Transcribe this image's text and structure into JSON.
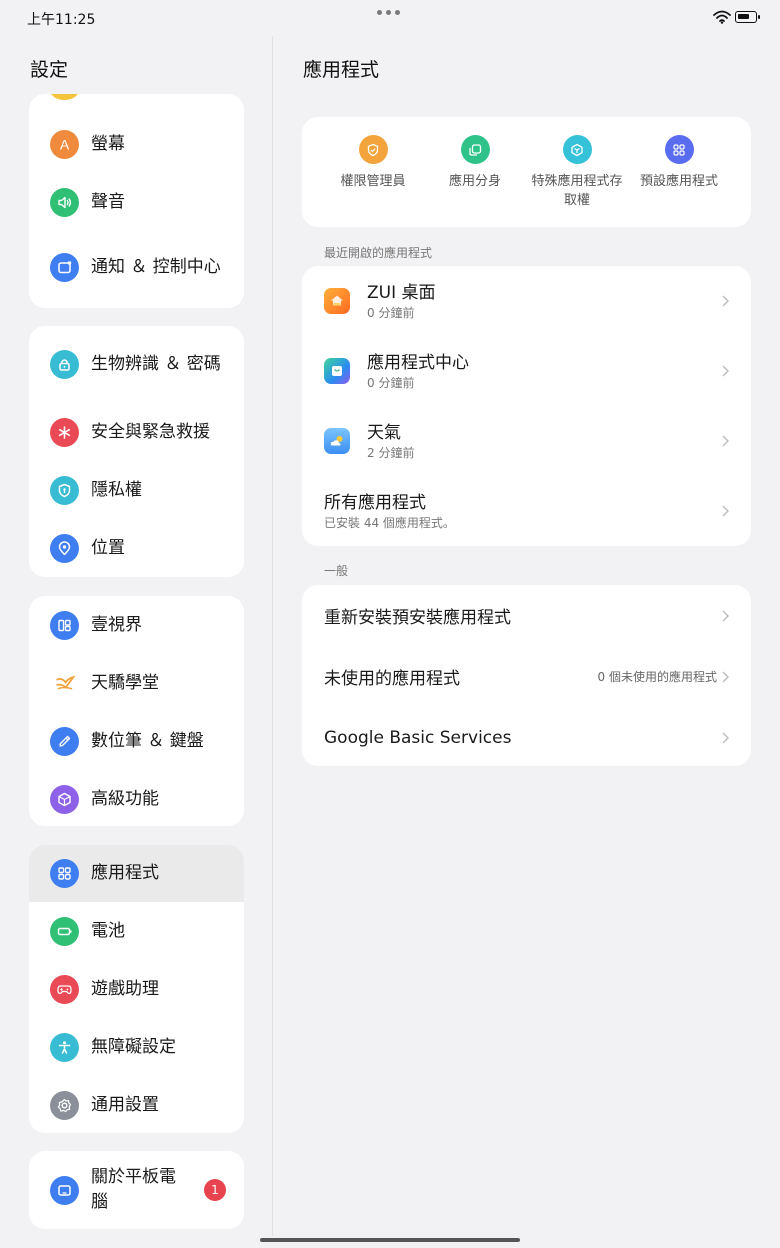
{
  "status_bar": {
    "time": "上午11:25"
  },
  "sidebar": {
    "title": "設定",
    "groups": [
      {
        "items": [
          {
            "label": "螢幕",
            "icon": "display-icon",
            "color": "#f08a3c"
          },
          {
            "label": "聲音",
            "icon": "speaker-icon",
            "color": "#2fbf75"
          },
          {
            "label": "通知 ＆ 控制中心",
            "icon": "notification-icon",
            "color": "#3f7ef0"
          }
        ]
      },
      {
        "items": [
          {
            "label": "生物辨識 ＆ 密碼",
            "icon": "lock-icon",
            "color": "#38bcd4"
          },
          {
            "label": "安全與緊急救援",
            "icon": "emergency-icon",
            "color": "#ea4a55"
          },
          {
            "label": "隱私權",
            "icon": "privacy-shield-icon",
            "color": "#38bcd4"
          },
          {
            "label": "位置",
            "icon": "location-pin-icon",
            "color": "#3f7ef0"
          }
        ]
      },
      {
        "items": [
          {
            "label": "壹視界",
            "icon": "multi-window-icon",
            "color": "#3f7ef0"
          },
          {
            "label": "天驕學堂",
            "icon": "academy-logo-icon",
            "color": "#f2a23a"
          },
          {
            "label": "數位筆 ＆ 鍵盤",
            "icon": "pen-icon",
            "color": "#3f7ef0"
          },
          {
            "label": "高級功能",
            "icon": "cube-icon",
            "color": "#8e62e8"
          }
        ]
      },
      {
        "items": [
          {
            "label": "應用程式",
            "icon": "apps-grid-icon",
            "color": "#3f7ef0"
          },
          {
            "label": "電池",
            "icon": "battery-icon",
            "color": "#2fbf75"
          },
          {
            "label": "遊戲助理",
            "icon": "gamepad-icon",
            "color": "#ea4a55"
          },
          {
            "label": "無障礙設定",
            "icon": "accessibility-icon",
            "color": "#38bcd4"
          },
          {
            "label": "通用設置",
            "icon": "gear-icon",
            "color": "#8a8f99"
          }
        ]
      },
      {
        "items": [
          {
            "label": "關於平板電腦",
            "icon": "tablet-icon",
            "color": "#3f7ef0",
            "badge": "1"
          }
        ]
      }
    ]
  },
  "main": {
    "title": "應用程式",
    "quick_actions": [
      {
        "label": "權限管理員",
        "icon": "permission-shield-icon",
        "color": "#f3a43c"
      },
      {
        "label": "應用分身",
        "icon": "app-clone-icon",
        "color": "#2fc38a"
      },
      {
        "label": "特殊應用程式存取權",
        "icon": "special-access-icon",
        "color": "#35c2d8"
      },
      {
        "label": "預設應用程式",
        "icon": "default-apps-icon",
        "color": "#5a6cf0"
      }
    ],
    "recent_header": "最近開啟的應用程式",
    "recent_apps": [
      {
        "name": "ZUI 桌面",
        "sub": "0 分鐘前",
        "icon": "zui-launcher-icon"
      },
      {
        "name": "應用程式中心",
        "sub": "0 分鐘前",
        "icon": "app-center-icon"
      },
      {
        "name": "天氣",
        "sub": "2 分鐘前",
        "icon": "weather-icon"
      }
    ],
    "all_apps": {
      "label": "所有應用程式",
      "sub": "已安裝 44 個應用程式。"
    },
    "general_header": "一般",
    "general_items": [
      {
        "label": "重新安裝預安裝應用程式",
        "value": ""
      },
      {
        "label": "未使用的應用程式",
        "value": "0 個未使用的應用程式"
      },
      {
        "label": "Google Basic Services",
        "value": ""
      }
    ]
  }
}
